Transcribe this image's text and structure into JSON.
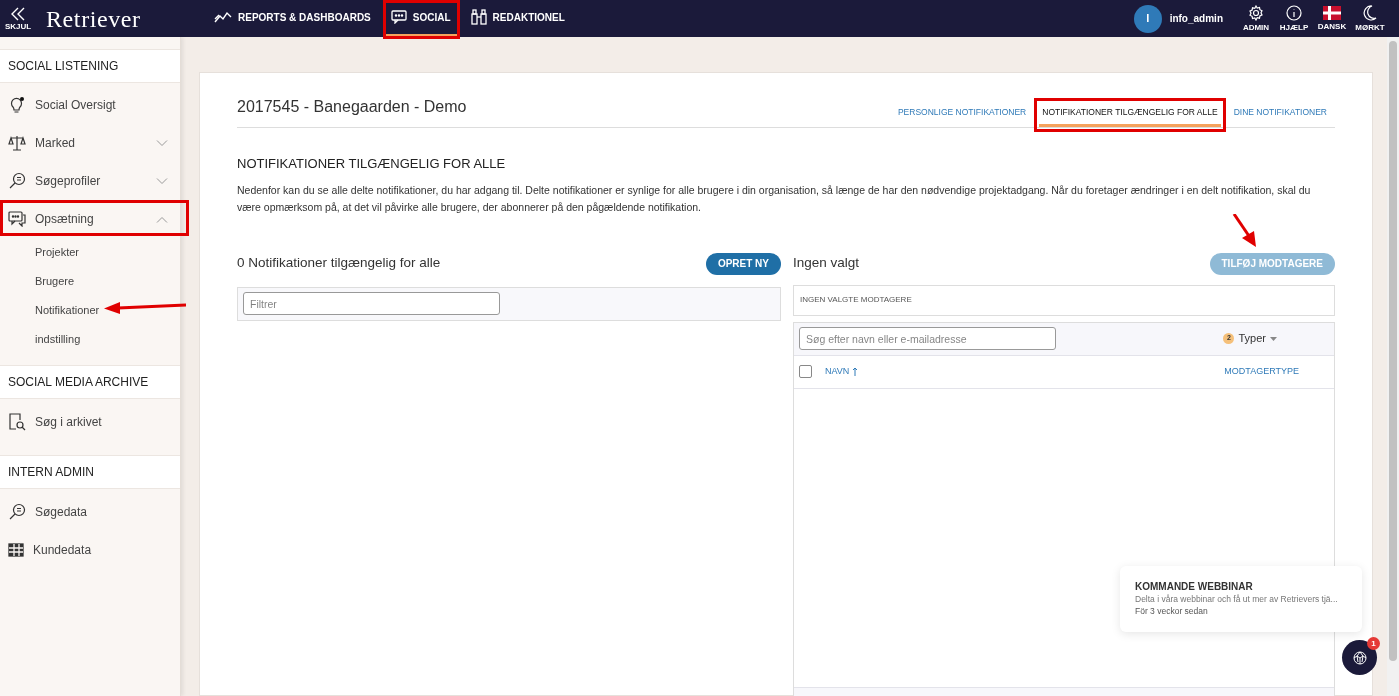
{
  "topbar": {
    "collapse_label": "SKJUL",
    "logo": "Retriever",
    "nav": [
      {
        "label": "REPORTS & DASHBOARDS",
        "selected": false
      },
      {
        "label": "SOCIAL",
        "selected": true
      },
      {
        "label": "REDAKTIONEL",
        "selected": false
      }
    ],
    "user": {
      "initial": "I",
      "name": "info_admin"
    },
    "actions": [
      {
        "label": "ADMIN"
      },
      {
        "label": "HJÆLP"
      },
      {
        "label": "DANSK"
      },
      {
        "label": "MØRKT"
      }
    ]
  },
  "sidebar": {
    "sections": [
      {
        "title": "SOCIAL LISTENING",
        "items": [
          {
            "label": "Social Oversigt"
          },
          {
            "label": "Marked",
            "expanded": false
          },
          {
            "label": "Søgeprofiler",
            "expanded": false
          },
          {
            "label": "Opsætning",
            "expanded": true,
            "children": [
              {
                "label": "Projekter"
              },
              {
                "label": "Brugere"
              },
              {
                "label": "Notifikationer"
              },
              {
                "label": "indstilling"
              }
            ]
          }
        ]
      },
      {
        "title": "SOCIAL MEDIA ARCHIVE",
        "items": [
          {
            "label": "Søg i arkivet"
          }
        ]
      },
      {
        "title": "INTERN ADMIN",
        "items": [
          {
            "label": "Søgedata"
          },
          {
            "label": "Kundedata"
          }
        ]
      }
    ]
  },
  "page": {
    "title": "2017545 - Banegaarden - Demo",
    "tabs": [
      {
        "label": "PERSONLIGE NOTIFIKATIONER",
        "selected": false
      },
      {
        "label": "NOTIFIKATIONER TILGÆNGELIG FOR ALLE",
        "selected": true
      },
      {
        "label": "DINE NOTIFIKATIONER",
        "selected": false
      }
    ],
    "heading": "NOTIFIKATIONER TILGÆNGELIG FOR ALLE",
    "description": "Nedenfor kan du se alle delte notifikationer, du har adgang til. Delte notifikationer er synlige for alle brugere i din organisation, så længe de har den nødvendige projektadgang. Når du foretager ændringer i en delt notifikation, skal du være opmærksom på, at det vil påvirke alle brugere, der abonnerer på den pågældende notifikation.",
    "left_panel": {
      "title": "0 Notifikationer tilgængelig for alle",
      "button": "OPRET NY",
      "filter": {
        "placeholder": "Filtrer"
      }
    },
    "right_panel": {
      "title": "Ingen valgt",
      "button": {
        "label": "TILFØJ MODTAGERE",
        "disabled": true
      },
      "selected_recipients": "INGEN VALGTE MODTAGERE",
      "search": {
        "placeholder": "Søg efter navn eller e-mailadresse"
      },
      "types_count": "2",
      "types_label": "Typer",
      "select_all_checked": false,
      "columns": [
        "NAVN",
        "MODTAGERTYPE"
      ]
    }
  },
  "toast": {
    "title": "KOMMANDE WEBBINAR",
    "text": "Delta i våra webbinar och få ut mer av Retrievers tjä...",
    "time": "För 3 veckor sedan"
  },
  "chat": {
    "badge": "1"
  }
}
